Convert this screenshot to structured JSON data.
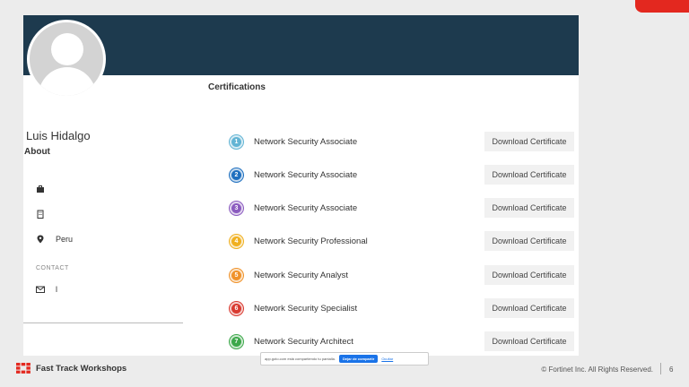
{
  "profile": {
    "name": "Luis Hidalgo",
    "about_label": "About",
    "location": "Peru",
    "contact_label": "CONTACT",
    "email": "l"
  },
  "certifications": {
    "title": "Certifications",
    "download_label": "Download Certificate",
    "items": [
      {
        "number": "1",
        "name": "Network Security Associate",
        "color": "#62b4d4"
      },
      {
        "number": "2",
        "name": "Network Security Associate",
        "color": "#1e6fbf"
      },
      {
        "number": "3",
        "name": "Network Security Associate",
        "color": "#8b5bbf"
      },
      {
        "number": "4",
        "name": "Network Security Professional",
        "color": "#f0b020"
      },
      {
        "number": "5",
        "name": "Network Security Analyst",
        "color": "#f0922a"
      },
      {
        "number": "6",
        "name": "Network Security Specialist",
        "color": "#d93a30"
      },
      {
        "number": "7",
        "name": "Network Security Architect",
        "color": "#3ca84a"
      }
    ]
  },
  "share_bar": {
    "message": "app.goto.com está compartiendo tu pantalla.",
    "stop_label": "Dejar de compartir",
    "hide_label": "Ocultar"
  },
  "footer": {
    "brand": "Fast Track Workshops",
    "copyright": "© Fortinet Inc. All Rights Reserved.",
    "page": "6"
  },
  "colors": {
    "banner": "#1d3a4e",
    "accent": "#e3281f"
  }
}
